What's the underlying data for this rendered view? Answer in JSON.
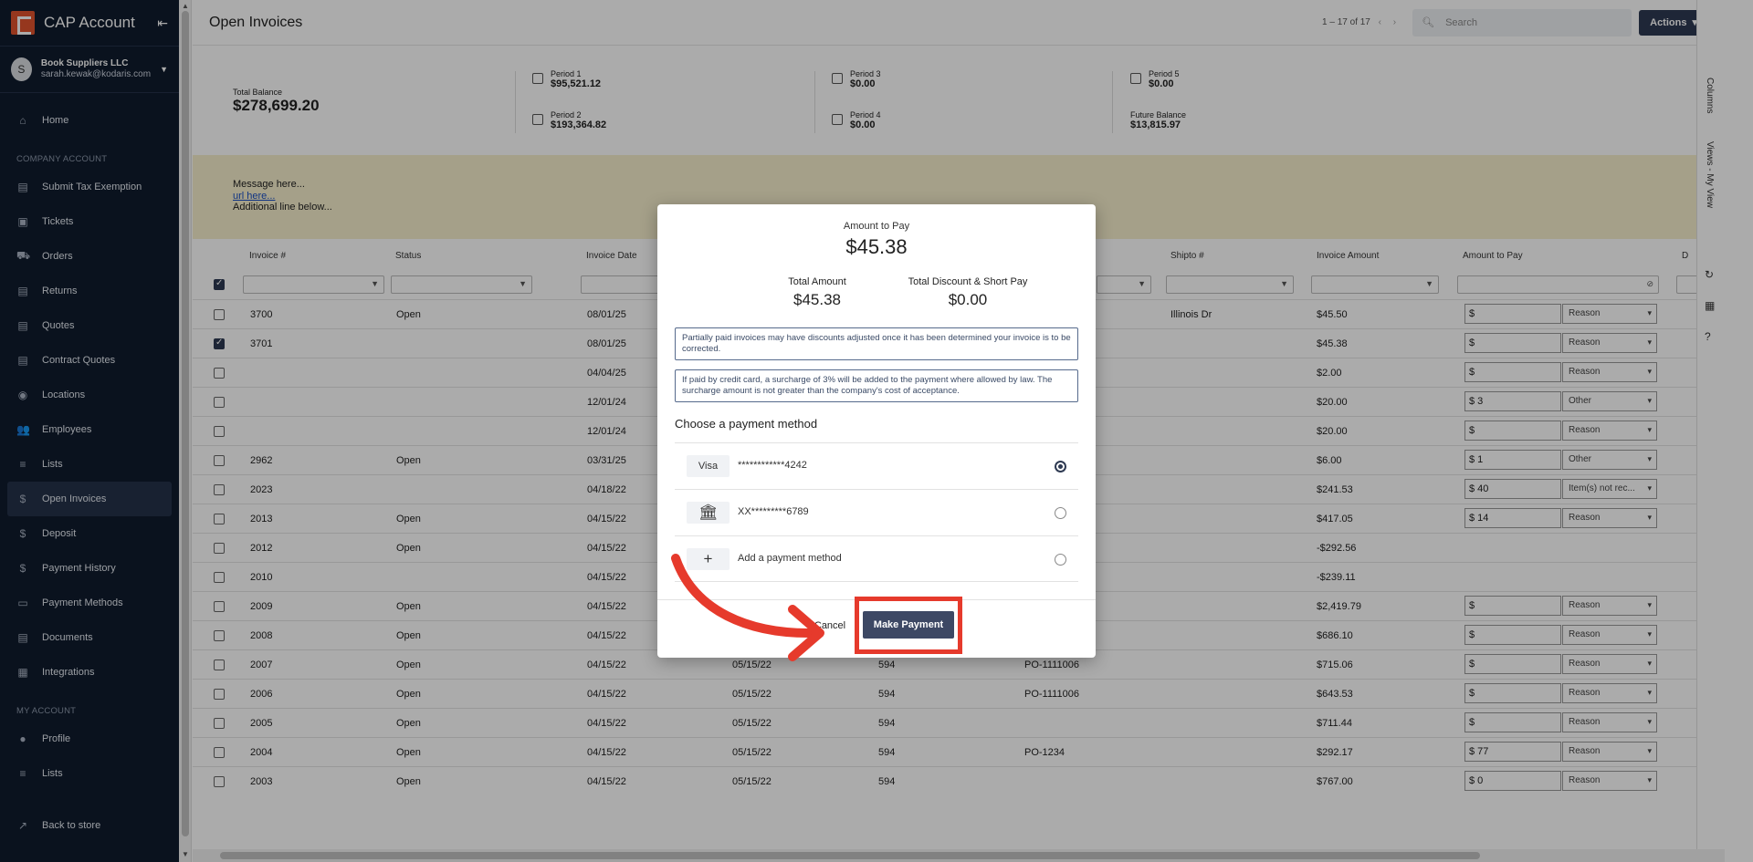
{
  "sidebar": {
    "brand": "CAP Account",
    "account": {
      "avatar": "S",
      "company": "Book Suppliers LLC",
      "email": "sarah.kewak@kodaris.com"
    },
    "items_top": [
      {
        "label": "Home",
        "icon": "⌂"
      }
    ],
    "section_company": "COMPANY ACCOUNT",
    "items_company": [
      {
        "label": "Submit Tax Exemption",
        "icon": "▤"
      },
      {
        "label": "Tickets",
        "icon": "▣"
      },
      {
        "label": "Orders",
        "icon": "⛟"
      },
      {
        "label": "Returns",
        "icon": "▤"
      },
      {
        "label": "Quotes",
        "icon": "▤"
      },
      {
        "label": "Contract Quotes",
        "icon": "▤"
      },
      {
        "label": "Locations",
        "icon": "◉"
      },
      {
        "label": "Employees",
        "icon": "👥"
      },
      {
        "label": "Lists",
        "icon": "≡"
      },
      {
        "label": "Open Invoices",
        "icon": "$"
      },
      {
        "label": "Deposit",
        "icon": "$"
      },
      {
        "label": "Payment History",
        "icon": "$"
      },
      {
        "label": "Payment Methods",
        "icon": "▭"
      },
      {
        "label": "Documents",
        "icon": "▤"
      },
      {
        "label": "Integrations",
        "icon": "▦"
      }
    ],
    "section_my": "MY ACCOUNT",
    "items_my": [
      {
        "label": "Profile",
        "icon": "●"
      },
      {
        "label": "Lists",
        "icon": "≡"
      }
    ],
    "back": {
      "label": "Back to store",
      "icon": "↗"
    }
  },
  "topbar": {
    "title": "Open Invoices",
    "pager": "1 – 17 of 17",
    "search_placeholder": "Search",
    "actions": "Actions"
  },
  "summary": {
    "total_balance_label": "Total Balance",
    "total_balance": "$278,699.20",
    "periods": [
      {
        "label": "Period 1",
        "value": "$95,521.12"
      },
      {
        "label": "Period 2",
        "value": "$193,364.82"
      },
      {
        "label": "Period 3",
        "value": "$0.00"
      },
      {
        "label": "Period 4",
        "value": "$0.00"
      },
      {
        "label": "Period 5",
        "value": "$0.00"
      }
    ],
    "future_label": "Future Balance",
    "future_value": "$13,815.97"
  },
  "message": {
    "line1": "Message here...",
    "url": "url here...",
    "line2": "Additional line below..."
  },
  "grid": {
    "columns": [
      "Invoice #",
      "Status",
      "Invoice Date",
      "Shipto #",
      "Invoice Amount",
      "Amount to Pay",
      "D"
    ],
    "rows": [
      {
        "inv": "3700",
        "status": "Open",
        "date": "08/01/25",
        "due": "",
        "num": "",
        "po": "",
        "shipto": "Illinois Dr",
        "amount": "$45.50",
        "pay": "$",
        "reason": "Reason",
        "checked": false,
        "show_pay": true
      },
      {
        "inv": "3701",
        "status": "",
        "date": "08/01/25",
        "due": "",
        "num": "",
        "po": "",
        "shipto": "",
        "amount": "$45.38",
        "pay": "$",
        "reason": "Reason",
        "checked": true,
        "show_pay": true
      },
      {
        "inv": "",
        "status": "",
        "date": "04/04/25",
        "due": "",
        "num": "",
        "po": "",
        "shipto": "",
        "amount": "$2.00",
        "pay": "$",
        "reason": "Reason",
        "checked": false,
        "show_pay": true
      },
      {
        "inv": "",
        "status": "",
        "date": "12/01/24",
        "due": "",
        "num": "",
        "po": "",
        "shipto": "",
        "amount": "$20.00",
        "pay": "$ 3",
        "reason": "Other",
        "checked": false,
        "show_pay": true
      },
      {
        "inv": "",
        "status": "",
        "date": "12/01/24",
        "due": "",
        "num": "",
        "po": "",
        "shipto": "",
        "amount": "$20.00",
        "pay": "$",
        "reason": "Reason",
        "checked": false,
        "show_pay": true
      },
      {
        "inv": "2962",
        "status": "Open",
        "date": "03/31/25",
        "due": "",
        "num": "",
        "po": "",
        "shipto": "",
        "amount": "$6.00",
        "pay": "$ 1",
        "reason": "Other",
        "checked": false,
        "show_pay": true
      },
      {
        "inv": "2023",
        "status": "",
        "date": "04/18/22",
        "due": "",
        "num": "",
        "po": "",
        "shipto": "",
        "amount": "$241.53",
        "pay": "$ 40",
        "reason": "Item(s) not rec...",
        "checked": false,
        "show_pay": true
      },
      {
        "inv": "2013",
        "status": "Open",
        "date": "04/15/22",
        "due": "",
        "num": "",
        "po": "",
        "shipto": "",
        "amount": "$417.05",
        "pay": "$ 14",
        "reason": "Reason",
        "checked": false,
        "show_pay": true
      },
      {
        "inv": "2012",
        "status": "Open",
        "date": "04/15/22",
        "due": "",
        "num": "",
        "po": "",
        "shipto": "",
        "amount": "-$292.56",
        "pay": "",
        "reason": "",
        "checked": false,
        "show_pay": false
      },
      {
        "inv": "2010",
        "status": "",
        "date": "04/15/22",
        "due": "",
        "num": "",
        "po": "",
        "shipto": "",
        "amount": "-$239.11",
        "pay": "",
        "reason": "",
        "checked": false,
        "show_pay": false
      },
      {
        "inv": "2009",
        "status": "Open",
        "date": "04/15/22",
        "due": "",
        "num": "",
        "po": "",
        "shipto": "",
        "amount": "$2,419.79",
        "pay": "$",
        "reason": "Reason",
        "checked": false,
        "show_pay": true
      },
      {
        "inv": "2008",
        "status": "Open",
        "date": "04/15/22",
        "due": "",
        "num": "",
        "po": "",
        "shipto": "",
        "amount": "$686.10",
        "pay": "$",
        "reason": "Reason",
        "checked": false,
        "show_pay": true
      },
      {
        "inv": "2007",
        "status": "Open",
        "date": "04/15/22",
        "due": "05/15/22",
        "num": "594",
        "po": "PO-1111006",
        "shipto": "",
        "amount": "$715.06",
        "pay": "$",
        "reason": "Reason",
        "checked": false,
        "show_pay": true
      },
      {
        "inv": "2006",
        "status": "Open",
        "date": "04/15/22",
        "due": "05/15/22",
        "num": "594",
        "po": "PO-1111006",
        "shipto": "",
        "amount": "$643.53",
        "pay": "$",
        "reason": "Reason",
        "checked": false,
        "show_pay": true
      },
      {
        "inv": "2005",
        "status": "Open",
        "date": "04/15/22",
        "due": "05/15/22",
        "num": "594",
        "po": "",
        "shipto": "",
        "amount": "$711.44",
        "pay": "$",
        "reason": "Reason",
        "checked": false,
        "show_pay": true
      },
      {
        "inv": "2004",
        "status": "Open",
        "date": "04/15/22",
        "due": "05/15/22",
        "num": "594",
        "po": "PO-1234",
        "shipto": "",
        "amount": "$292.17",
        "pay": "$ 77",
        "reason": "Reason",
        "checked": false,
        "show_pay": true
      },
      {
        "inv": "2003",
        "status": "Open",
        "date": "04/15/22",
        "due": "05/15/22",
        "num": "594",
        "po": "",
        "shipto": "",
        "amount": "$767.00",
        "pay": "$ 0",
        "reason": "Reason",
        "checked": false,
        "show_pay": true
      }
    ]
  },
  "side_strip": {
    "columns": "Columns",
    "views": "Views - My View"
  },
  "modal": {
    "amount_label": "Amount to Pay",
    "amount": "$45.38",
    "total_label": "Total Amount",
    "total": "$45.38",
    "discount_label": "Total Discount & Short Pay",
    "discount": "$0.00",
    "notice1": "Partially paid invoices may have discounts adjusted once it has been determined your invoice is to be corrected.",
    "notice2": "If paid by credit card, a surcharge of 3% will be added to the payment where allowed by law. The surcharge amount is not greater than the company's cost of acceptance.",
    "choose_label": "Choose a payment method",
    "methods": [
      {
        "badge": "Visa",
        "text": "************4242",
        "selected": true
      },
      {
        "badge": "bank-icon",
        "text": "XX*********6789",
        "selected": false
      },
      {
        "badge": "+",
        "text": "Add a payment method",
        "selected": false
      }
    ],
    "cancel": "Cancel",
    "pay": "Make Payment"
  },
  "colors": {
    "sidebar": "#0f1b2d",
    "primary": "#2e3a52",
    "highlight": "#e63a2c",
    "message_bg": "#f6efcd"
  }
}
